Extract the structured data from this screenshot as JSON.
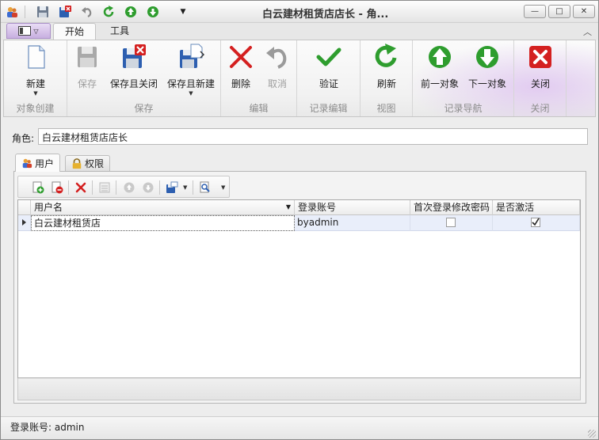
{
  "window": {
    "title": "白云建材租赁店店长 - 角...",
    "min_symbol": "—",
    "max_symbol": "□",
    "close_symbol": "✕"
  },
  "quick_access": {
    "icons": [
      "app-users-icon",
      "save-icon",
      "save-close-icon",
      "undo-icon",
      "refresh-icon",
      "up-icon",
      "down-icon",
      "customize-dropdown-icon"
    ]
  },
  "ribbon": {
    "collapse_symbol": "︿",
    "tabs": [
      {
        "label": "开始",
        "active": true
      },
      {
        "label": "工具",
        "active": false
      }
    ],
    "groups": [
      {
        "label": "对象创建",
        "buttons": [
          {
            "label": "新建",
            "icon": "new-document-icon",
            "enabled": true,
            "dropdown": true
          }
        ]
      },
      {
        "label": "保存",
        "buttons": [
          {
            "label": "保存",
            "icon": "save-icon",
            "enabled": false
          },
          {
            "label": "保存且关闭",
            "icon": "save-close-icon",
            "enabled": true
          },
          {
            "label": "保存且新建",
            "icon": "save-new-icon",
            "enabled": true,
            "dropdown": true
          }
        ]
      },
      {
        "label": "编辑",
        "buttons": [
          {
            "label": "删除",
            "icon": "delete-icon",
            "enabled": true
          },
          {
            "label": "取消",
            "icon": "undo-icon",
            "enabled": false
          }
        ]
      },
      {
        "label": "记录编辑",
        "buttons": [
          {
            "label": "验证",
            "icon": "checkmark-icon",
            "enabled": true
          }
        ]
      },
      {
        "label": "视图",
        "buttons": [
          {
            "label": "刷新",
            "icon": "refresh-icon",
            "enabled": true
          }
        ]
      },
      {
        "label": "记录导航",
        "buttons": [
          {
            "label": "前一对象",
            "icon": "previous-icon",
            "enabled": true
          },
          {
            "label": "下一对象",
            "icon": "next-icon",
            "enabled": true
          }
        ]
      },
      {
        "label": "关闭",
        "buttons": [
          {
            "label": "关闭",
            "icon": "close-icon",
            "enabled": true
          }
        ]
      }
    ]
  },
  "form": {
    "role_label": "角色:",
    "role_value": "白云建材租赁店店长"
  },
  "detail_tabs": [
    {
      "label": "用户",
      "icon": "users-icon",
      "active": true
    },
    {
      "label": "权限",
      "icon": "lock-icon",
      "active": false
    }
  ],
  "users_grid": {
    "columns": [
      "用户名",
      "登录账号",
      "首次登录修改密码",
      "是否激活"
    ],
    "rows": [
      {
        "username": "白云建材租赁店",
        "login": "byadmin",
        "change_password_first_login": false,
        "active": true
      }
    ]
  },
  "status_bar": {
    "text": "登录账号: admin"
  },
  "colors": {
    "ribbon_accent": "#c8afe0",
    "selected_row": "#e9eefa",
    "delete_red": "#d42020",
    "ok_green": "#2e9d2e"
  }
}
